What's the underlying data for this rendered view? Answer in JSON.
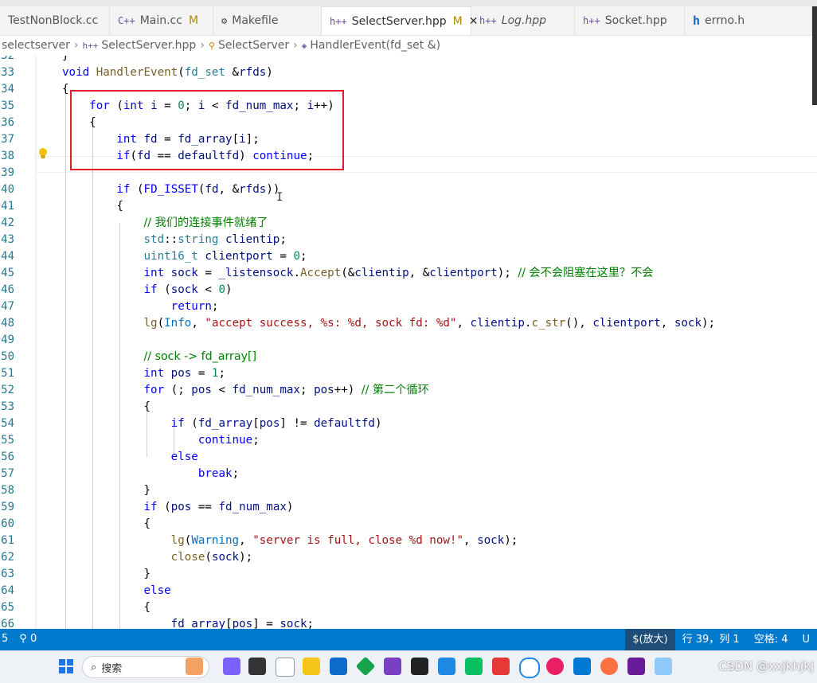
{
  "tabs": [
    {
      "icon": "",
      "label": "TestNonBlock.cc",
      "mod": ""
    },
    {
      "icon": "C++",
      "label": "Main.cc",
      "mod": "M"
    },
    {
      "icon": "",
      "label": "Makefile",
      "mod": ""
    },
    {
      "icon": "h++",
      "label": "SelectServer.hpp",
      "mod": "M"
    },
    {
      "icon": "h++",
      "label": "Log.hpp",
      "mod": ""
    },
    {
      "icon": "h++",
      "label": "Socket.hpp",
      "mod": ""
    },
    {
      "icon": "h",
      "label": "errno.h",
      "mod": ""
    }
  ],
  "breadcrumb": {
    "folder": "selectserver",
    "file": "SelectServer.hpp",
    "cls": "SelectServer",
    "method": "HandlerEvent(fd_set &)"
  },
  "line_numbers": [
    "32",
    "33",
    "34",
    "35",
    "36",
    "37",
    "38",
    "39",
    "40",
    "41",
    "42",
    "43",
    "44",
    "45",
    "46",
    "47",
    "48",
    "49",
    "50",
    "51",
    "52",
    "53",
    "54",
    "55",
    "56",
    "57",
    "58",
    "59",
    "60",
    "61",
    "62",
    "63",
    "64",
    "65",
    "66"
  ],
  "code": {
    "l33_fn": "HandlerEvent",
    "l33_type": "fd_set",
    "l33_param": "rfds",
    "l42": "// 我们的连接事件就绪了",
    "l45_comment": "// 会不会阻塞在这里？不会",
    "l48_str": "\"accept success, %s: %d, sock fd: %d\"",
    "l50": "// sock -> fd_array[]",
    "l52_comment": "// 第二个循环",
    "l61_str": "\"server is full, close %d now!\""
  },
  "status": {
    "left_line": "5",
    "ports": "0",
    "zoom": "$(放大)",
    "position": "行 39，列 1",
    "spaces": "空格: 4",
    "encoding": "U"
  },
  "taskbar": {
    "search": "搜索",
    "watermark": "CSDN @xxjkhjkj"
  }
}
